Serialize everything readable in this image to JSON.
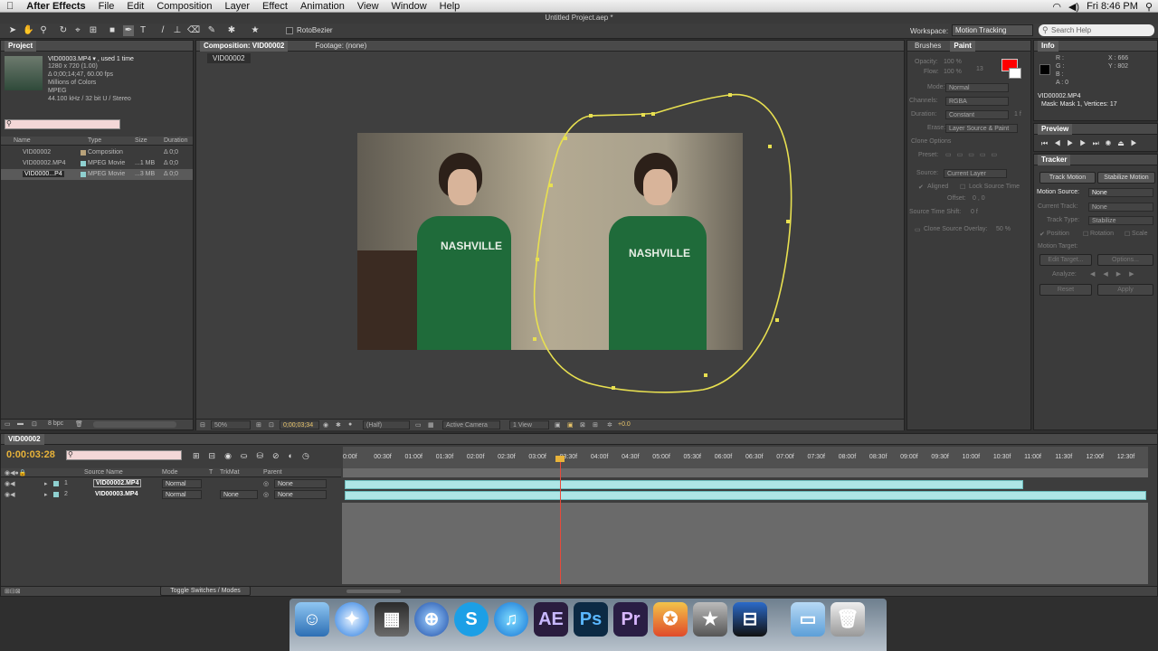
{
  "menubar": {
    "apple": "",
    "app": "After Effects",
    "items": [
      "File",
      "Edit",
      "Composition",
      "Layer",
      "Effect",
      "Animation",
      "View",
      "Window",
      "Help"
    ],
    "clock": "Fri 8:46 PM"
  },
  "title": "Untitled Project.aep *",
  "toolbar": {
    "rotobezier": "RotoBezier",
    "workspace_label": "Workspace:",
    "workspace_value": "Motion Tracking",
    "search_placeholder": "Search Help"
  },
  "project": {
    "tab": "Project",
    "file_name": "VID00003.MP4 ▾ , used 1 time",
    "dims": "1280 x 720 (1.00)",
    "duration": "Δ 0;00;14;47, 60.00 fps",
    "colors": "Millions of Colors",
    "codec": "MPEG",
    "audio": "44.100 kHz / 32 bit U / Stereo",
    "headers": [
      "Name",
      "Type",
      "Size",
      "Duration"
    ],
    "items": [
      {
        "name": "VID00002",
        "type": "Composition",
        "size": "",
        "duration": "Δ 0;0"
      },
      {
        "name": "VID00002.MP4",
        "type": "MPEG Movie",
        "size": "...1 MB",
        "duration": "Δ 0;0"
      },
      {
        "name": "VID0000...P4",
        "type": "MPEG Movie",
        "size": "...3 MB",
        "duration": "Δ 0;0"
      }
    ],
    "bpc": "8 bpc"
  },
  "viewer": {
    "comp_tab": "Composition: VID00002",
    "footage_tab": "Footage: (none)",
    "comp_name": "VID00002",
    "zoom": "50%",
    "timecode": "0;00;03;34",
    "resolution": "(Half)",
    "camera": "Active Camera",
    "views": "1 View",
    "exposure": "+0.0"
  },
  "paint": {
    "tabs": [
      "Brushes",
      "Paint"
    ],
    "opacity_label": "Opacity:",
    "opacity": "100 %",
    "flow_label": "Flow:",
    "flow": "100 %",
    "size": "13",
    "mode_label": "Mode:",
    "mode": "Normal",
    "channels_label": "Channels:",
    "channels": "RGBA",
    "duration_label": "Duration:",
    "duration": "Constant",
    "duration_val": "1 f",
    "erase_label": "Erase:",
    "erase": "Layer Source & Paint",
    "clone_options": "Clone Options",
    "preset_label": "Preset:",
    "source_label": "Source:",
    "source": "Current Layer",
    "aligned": "Aligned",
    "lock_source": "Lock Source Time",
    "offset_label": "Offset:",
    "offset": "0 ,   0",
    "shift_label": "Source Time Shift:",
    "shift": "0 f",
    "overlay": "Clone Source Overlay:",
    "overlay_val": "50 %",
    "swatch_color": "#ff0000"
  },
  "info": {
    "tab": "Info",
    "r": "R :",
    "g": "G :",
    "b": "B :",
    "a": "A : 0",
    "x": "X : 666",
    "y": "Y : 802",
    "layer": "VID00002.MP4",
    "mask": "Mask: Mask 1, Vertices: 17"
  },
  "preview": {
    "tab": "Preview"
  },
  "tracker": {
    "tab": "Tracker",
    "track_motion": "Track Motion",
    "stabilize": "Stabilize Motion",
    "motion_source_label": "Motion Source:",
    "motion_source": "None",
    "current_track_label": "Current Track:",
    "current_track": "None",
    "track_type_label": "Track Type:",
    "track_type": "Stabilize",
    "position": "Position",
    "rotation": "Rotation",
    "scale": "Scale",
    "motion_target": "Motion Target:",
    "edit_target": "Edit Target...",
    "options": "Options...",
    "analyze": "Analyze:",
    "reset": "Reset",
    "apply": "Apply"
  },
  "timeline": {
    "tab": "VID00002",
    "timecode": "0:00:03:28",
    "ruler": [
      "0:00f",
      "00:30f",
      "01:00f",
      "01:30f",
      "02:00f",
      "02:30f",
      "03:00f",
      "03:30f",
      "04:00f",
      "04:30f",
      "05:00f",
      "05:30f",
      "06:00f",
      "06:30f",
      "07:00f",
      "07:30f",
      "08:00f",
      "08:30f",
      "09:00f",
      "09:30f",
      "10:00f",
      "10:30f",
      "11:00f",
      "11:30f",
      "12:00f",
      "12:30f"
    ],
    "headers": [
      "Source Name",
      "Mode",
      "T",
      "TrkMat",
      "Parent"
    ],
    "layers": [
      {
        "num": "1",
        "name": "VID00002.MP4",
        "mode": "Normal",
        "trkmat": "",
        "parent": "None"
      },
      {
        "num": "2",
        "name": "VID00003.MP4",
        "mode": "Normal",
        "trkmat": "None",
        "parent": "None"
      }
    ],
    "toggle": "Toggle Switches / Modes"
  },
  "dock": {
    "ae": "AE",
    "ps": "Ps",
    "pr": "Pr"
  }
}
